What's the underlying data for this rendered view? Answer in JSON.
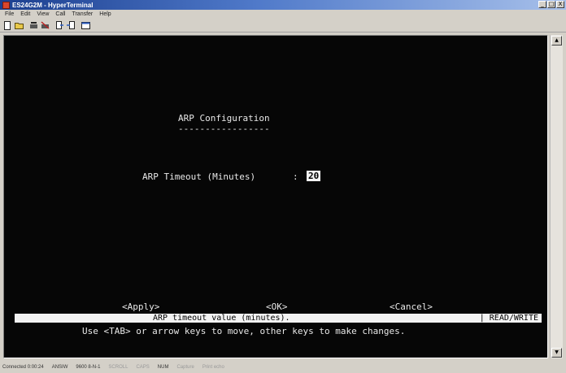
{
  "window": {
    "title": "ES24G2M - HyperTerminal",
    "minimize": "_",
    "maximize": "□",
    "close": "X"
  },
  "menu": [
    "File",
    "Edit",
    "View",
    "Call",
    "Transfer",
    "Help"
  ],
  "toolbar": {
    "icons": [
      "new-icon",
      "open-icon",
      "phone-icon",
      "disconnect-icon",
      "send-icon",
      "receive-icon",
      "properties-icon"
    ]
  },
  "terminal": {
    "heading": "ARP Configuration",
    "heading_underline": "-----------------",
    "field_label": "ARP Timeout (Minutes)",
    "field_separator": ":",
    "field_value": "20",
    "buttons": {
      "apply": "<Apply>",
      "ok": "<OK>",
      "cancel": "<Cancel>"
    },
    "status_help": "ARP timeout value (minutes).",
    "status_mode": "| READ/WRITE",
    "instructions": "Use <TAB> or arrow keys to move, other keys to make changes."
  },
  "footer": {
    "connected": "Connected 0:00:24",
    "emulation": "ANSIW",
    "settings": "9600 8-N-1",
    "scroll": "SCROLL",
    "caps": "CAPS",
    "num": "NUM",
    "capture": "Capture",
    "echo": "Print echo"
  }
}
